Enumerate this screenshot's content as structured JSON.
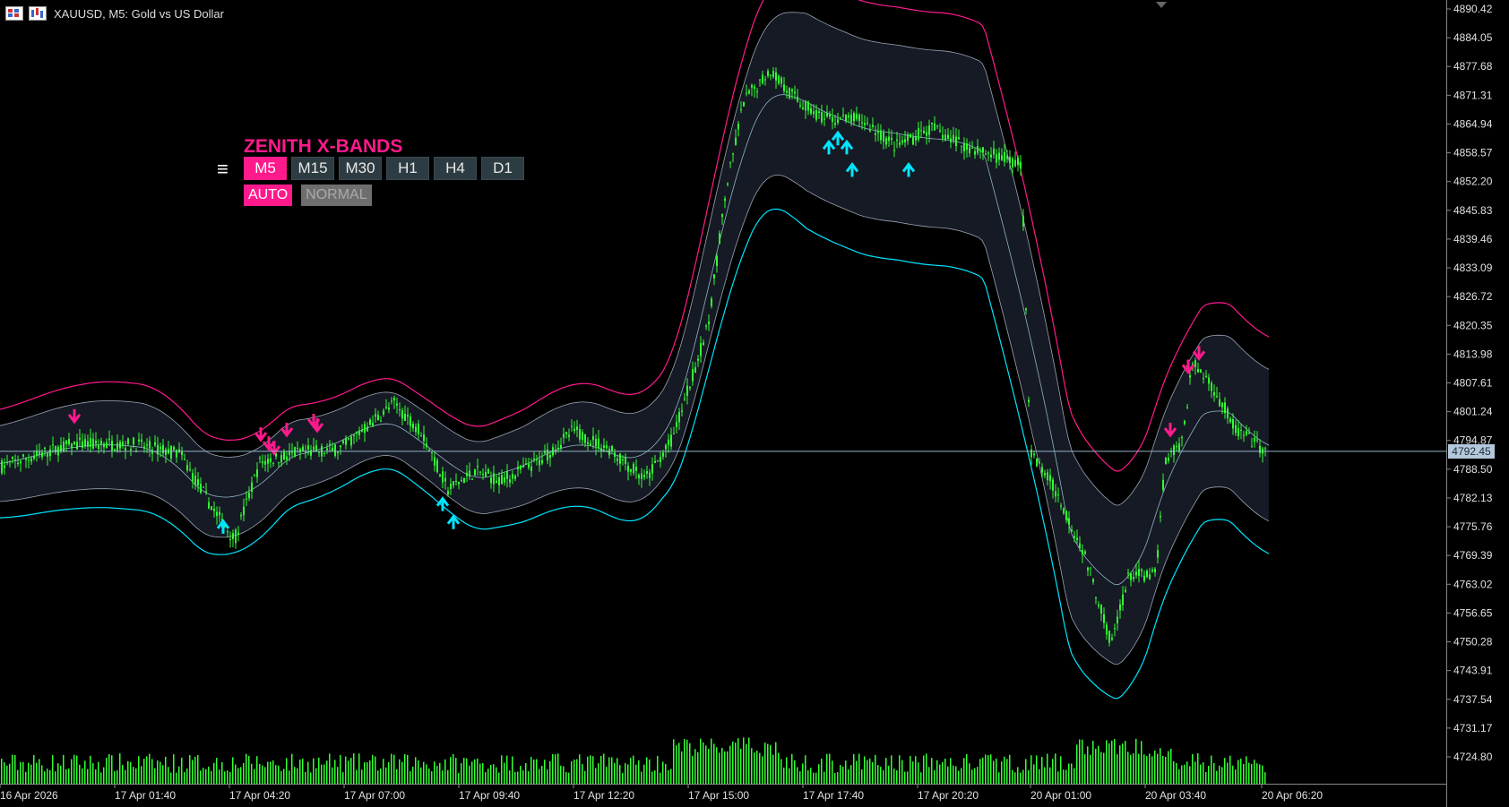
{
  "header": {
    "symbol_title": "XAUUSD, M5:  Gold vs US Dollar"
  },
  "panel": {
    "menu_glyph": "≡",
    "title": "ZENITH X-BANDS",
    "timeframes": [
      {
        "label": "M5",
        "active": true
      },
      {
        "label": "M15",
        "active": false
      },
      {
        "label": "M30",
        "active": false
      },
      {
        "label": "H1",
        "active": false
      },
      {
        "label": "H4",
        "active": false
      },
      {
        "label": "D1",
        "active": false
      }
    ],
    "modes": [
      {
        "label": "AUTO",
        "active": true
      },
      {
        "label": "NORMAL",
        "active": false
      }
    ]
  },
  "current_price": "4792.45",
  "colors": {
    "candle": "#33ff33",
    "upper_band": "#ff1a8c",
    "lower_band": "#00e5ff",
    "band_fill": "#161a24",
    "mid_line": "#8fb4c8",
    "price_line": "#8fb4c8",
    "buy_arrow": "#00e5ff",
    "sell_arrow": "#ff1a8c",
    "volume": "#33ff33"
  },
  "chart_data": {
    "type": "candlestick",
    "title": "XAUUSD, M5:  Gold vs US Dollar",
    "y_ticks": [
      "4890.42",
      "4884.05",
      "4877.68",
      "4871.31",
      "4864.94",
      "4858.57",
      "4852.20",
      "4845.83",
      "4839.46",
      "4833.09",
      "4826.72",
      "4820.35",
      "4813.98",
      "4807.61",
      "4801.24",
      "4794.87",
      "4788.50",
      "4782.13",
      "4775.76",
      "4769.39",
      "4763.02",
      "4756.65",
      "4750.28",
      "4743.91",
      "4737.54",
      "4731.17",
      "4724.80"
    ],
    "x_ticks": [
      "16 Apr 2026",
      "17 Apr 01:40",
      "17 Apr 04:20",
      "17 Apr 07:00",
      "17 Apr 09:40",
      "17 Apr 12:20",
      "17 Apr 15:00",
      "17 Apr 17:40",
      "17 Apr 20:20",
      "20 Apr 01:00",
      "20 Apr 03:40",
      "20 Apr 06:20"
    ],
    "ylim": [
      4724.8,
      4890.42
    ],
    "current_price": 4792.45
  }
}
